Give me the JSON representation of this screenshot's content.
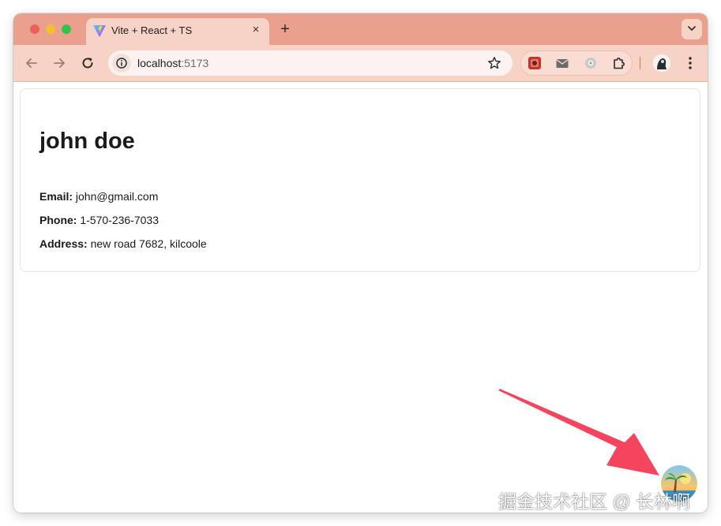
{
  "browser": {
    "tab_title": "Vite + React + TS",
    "tab_close": "×",
    "new_tab": "+",
    "url_host": "localhost",
    "url_port": ":5173",
    "icons": {
      "back": "back-arrow-icon",
      "forward": "forward-arrow-icon",
      "reload": "reload-icon",
      "site_info": "info-icon",
      "bookmark": "star-icon",
      "extensions": "puzzle-icon",
      "menu": "more-vertical-icon"
    },
    "colors": {
      "titlebar": "#e9a18e",
      "toolbar": "#f7d3c6"
    }
  },
  "profile": {
    "name": "john doe",
    "fields": [
      {
        "label": "Email:",
        "value": "john@gmail.com"
      },
      {
        "label": "Phone:",
        "value": "1-570-236-7033"
      },
      {
        "label": "Address:",
        "value": "new road 7682, kilcoole"
      }
    ]
  },
  "overlay": {
    "arrow_color": "#f5445e",
    "watermark": "掘金技术社区 @ 长林啊"
  }
}
